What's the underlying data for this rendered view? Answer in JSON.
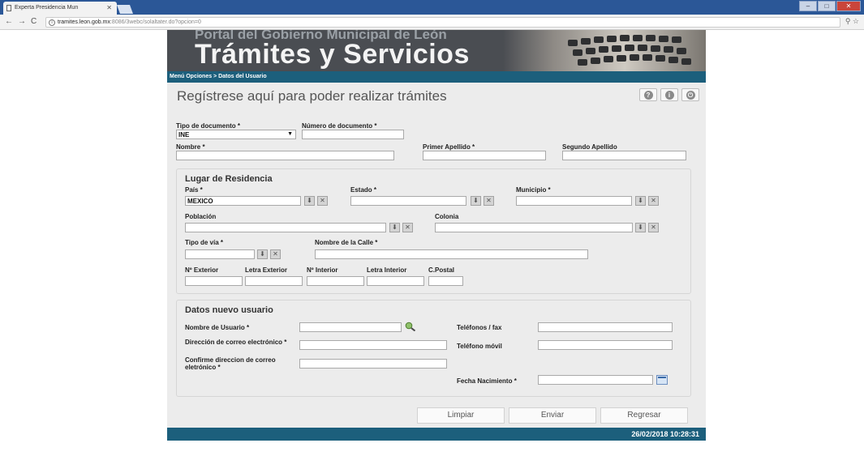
{
  "browser": {
    "tab_title": "Experta Presidencia Mun",
    "url_host": "tramites.leon.gob.mx",
    "url_path": ":8086/3webc/solaltater.do?opcion=0"
  },
  "banner": {
    "subtitle": "Portal del Gobierno Municipal de León",
    "title": "Trámites y Servicios"
  },
  "breadcrumb": "Menú Opciones > Datos del Usuario",
  "page_title": "Regístrese aquí para poder realizar trámites",
  "doc": {
    "tipo_label": "Tipo de documento *",
    "tipo_value": "INE",
    "numero_label": "Número de documento *",
    "nombre_label": "Nombre *",
    "primer_apellido_label": "Primer Apellido *",
    "segundo_apellido_label": "Segundo Apellido"
  },
  "residencia": {
    "title": "Lugar de Residencia",
    "pais_label": "País *",
    "pais_value": "MEXICO",
    "estado_label": "Estado *",
    "municipio_label": "Municipio *",
    "poblacion_label": "Población",
    "colonia_label": "Colonia",
    "tipo_via_label": "Tipo de vía *",
    "calle_label": "Nombre de la Calle *",
    "n_exterior_label": "Nº Exterior",
    "letra_exterior_label": "Letra Exterior",
    "n_interior_label": "Nº Interior",
    "letra_interior_label": "Letra Interior",
    "cpostal_label": "C.Postal"
  },
  "usuario": {
    "title": "Datos nuevo usuario",
    "nombre_usuario_label": "Nombre de Usuario *",
    "correo_label": "Dirección de correo electrónico *",
    "confirme_label": "Confirme direccion de correo eletrónico *",
    "telefonos_label": "Teléfonos / fax",
    "movil_label": "Teléfono móvil",
    "fecha_label": "Fecha Nacimiento *"
  },
  "buttons": {
    "limpiar": "Limpiar",
    "enviar": "Enviar",
    "regresar": "Regresar"
  },
  "footer_datetime": "26/02/2018 10:28:31"
}
